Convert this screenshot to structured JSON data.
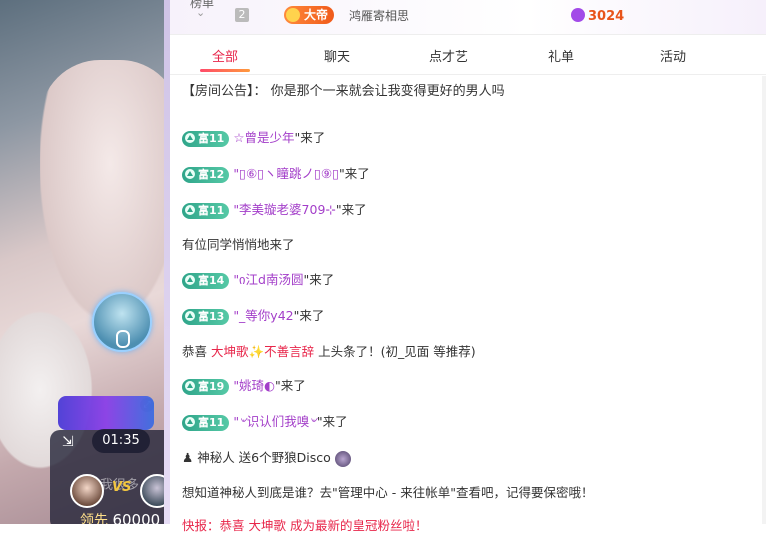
{
  "top_rank": {
    "prev_text": "榜单",
    "rank_number": "2",
    "noble_label": "大帝",
    "user_name": "鸿雁寄相思",
    "points": "3024"
  },
  "tabs": [
    "全部",
    "聊天",
    "点才艺",
    "礼单",
    "活动"
  ],
  "active_tab": "全部",
  "announcement": {
    "prefix": "【房间公告】：",
    "text": "你是那个一来就会让我变得更好的男人吗"
  },
  "messages": [
    {
      "type": "enter",
      "level": "富11",
      "name": "☆曾是少年",
      "suffix": "\"来了"
    },
    {
      "type": "enter",
      "level": "富12",
      "name": "\"▯⑥▯ヽ瞳跳ノ▯⑨▯",
      "suffix": "\"来了"
    },
    {
      "type": "enter",
      "level": "富11",
      "name": "\"李美璇老婆709⊹",
      "suffix": "\"来了"
    },
    {
      "type": "text",
      "text": "有位同学悄悄地来了"
    },
    {
      "type": "enter",
      "level": "富14",
      "name": "\"ი江d南汤圆",
      "suffix": "\"来了"
    },
    {
      "type": "enter",
      "level": "富13",
      "name": "\"_等你y42",
      "suffix": "\"来了"
    },
    {
      "type": "headline",
      "prefix": "恭喜",
      "user": "大坤歌",
      "user2": "不善言辞",
      "text": "上头条了！(初_见面 等推荐)"
    },
    {
      "type": "enter",
      "level": "富19",
      "name": "\"姚琦◐",
      "suffix": "\"来了"
    },
    {
      "type": "enter",
      "level": "富11",
      "name": "\"৺识认们我嗅৺",
      "suffix": "\"来了"
    },
    {
      "type": "gift",
      "text": "神秘人 送6个野狼Disco"
    },
    {
      "type": "text",
      "text": "想知道神秘人到底是谁？去\"管理中心 - 来往帐单\"查看吧，记得要保密哦！"
    },
    {
      "type": "partial",
      "text": "快报：恭喜 大坤歌 成为最新的皇冠粉丝啦！"
    }
  ],
  "pk": {
    "timer": "01:35",
    "label": "我很多",
    "vs": "VS",
    "lead_prefix": "领先",
    "lead_value": "60000"
  },
  "colors": {
    "accent_red": "#e8264a",
    "username_purple": "#a33ec9",
    "level_badge_green": "#2fa58a",
    "points_orange": "#e8541a"
  }
}
